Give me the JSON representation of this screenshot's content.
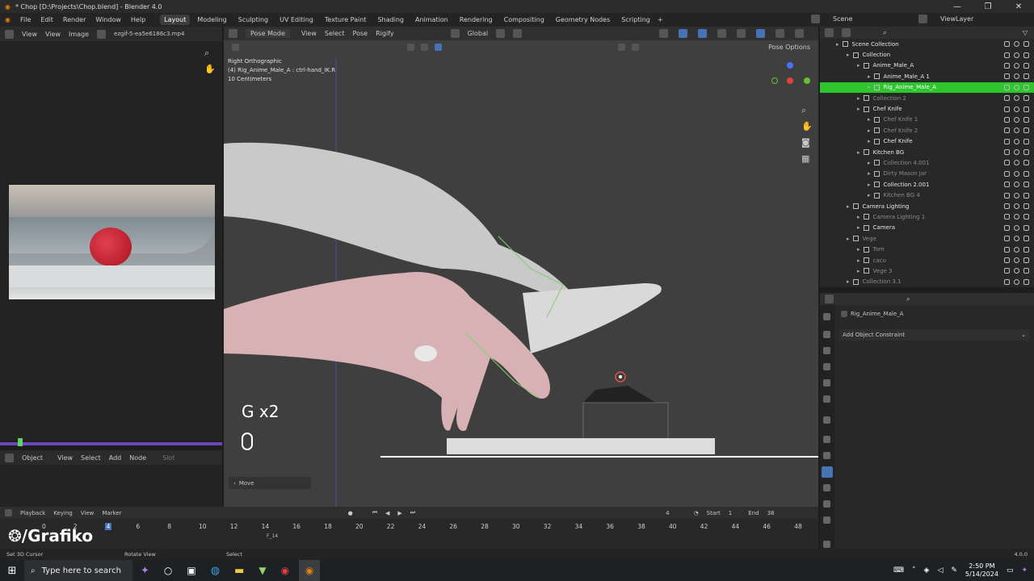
{
  "title": "* Chop [D:\\Projects\\Chop.blend] - Blender 4.0",
  "menus": [
    "File",
    "Edit",
    "Render",
    "Window",
    "Help"
  ],
  "workspaces": [
    "Layout",
    "Modeling",
    "Sculpting",
    "UV Editing",
    "Texture Paint",
    "Shading",
    "Animation",
    "Rendering",
    "Compositing",
    "Geometry Nodes",
    "Scripting"
  ],
  "scene": "Scene",
  "viewlayer": "ViewLayer",
  "image_editor": {
    "view": "View",
    "view2": "View",
    "image": "Image",
    "filename": "ezgif-5-ea5e6186c3.mp4"
  },
  "node_editor": {
    "mode": "Object",
    "view": "View",
    "select": "Select",
    "add": "Add",
    "node": "Node",
    "slot": "Slot"
  },
  "viewport": {
    "mode": "Pose Mode",
    "view": "View",
    "select": "Select",
    "pose": "Pose",
    "rigify": "Rigify",
    "transform": "Global",
    "info1": "Right Orthographic",
    "info2": "(4) Rig_Anime_Male_A : ctrl-hand_IK.R",
    "info3": "10 Centimeters",
    "options": "Pose Options",
    "key_hint": "G x2",
    "operator": "Move"
  },
  "outliner": [
    {
      "name": "Scene Collection",
      "indent": 0,
      "dim": false
    },
    {
      "name": "Collection",
      "indent": 1,
      "dim": false
    },
    {
      "name": "Anime_Male_A",
      "indent": 2,
      "dim": false
    },
    {
      "name": "Anime_Male_A 1",
      "indent": 3,
      "dim": false
    },
    {
      "name": "Rig_Anime_Male_A",
      "indent": 3,
      "dim": false,
      "hl": true
    },
    {
      "name": "Collection 2",
      "indent": 2,
      "dim": true
    },
    {
      "name": "Chef Knife",
      "indent": 2,
      "dim": false
    },
    {
      "name": "Chef Knife 1",
      "indent": 3,
      "dim": true
    },
    {
      "name": "Chef Knife 2",
      "indent": 3,
      "dim": true
    },
    {
      "name": "Chef Knife",
      "indent": 3,
      "dim": false
    },
    {
      "name": "Kitchen BG",
      "indent": 2,
      "dim": false
    },
    {
      "name": "Collection 4.001",
      "indent": 3,
      "dim": true
    },
    {
      "name": "Dirty Mason Jar",
      "indent": 3,
      "dim": true
    },
    {
      "name": "Collection 2.001",
      "indent": 3,
      "dim": false
    },
    {
      "name": "Kitchen BG 4",
      "indent": 3,
      "dim": true
    },
    {
      "name": "Camera Lighting",
      "indent": 1,
      "dim": false
    },
    {
      "name": "Camera Lighting 1",
      "indent": 2,
      "dim": true
    },
    {
      "name": "Camera",
      "indent": 2,
      "dim": false
    },
    {
      "name": "Vege",
      "indent": 1,
      "dim": true
    },
    {
      "name": "Tom",
      "indent": 2,
      "dim": true
    },
    {
      "name": "cacu",
      "indent": 2,
      "dim": true
    },
    {
      "name": "Vege 3",
      "indent": 2,
      "dim": true
    },
    {
      "name": "Collection 3.1",
      "indent": 1,
      "dim": true
    }
  ],
  "properties": {
    "object": "Rig_Anime_Male_A",
    "add": "Add Object Constraint"
  },
  "timeline": {
    "playback": "Playback",
    "keying": "Keying",
    "view": "View",
    "marker": "Marker",
    "current": "4",
    "start_label": "Start",
    "start": "1",
    "end_label": "End",
    "end": "38",
    "ticks": [
      "0",
      "2",
      "4",
      "6",
      "8",
      "10",
      "12",
      "14",
      "16",
      "18",
      "20",
      "22",
      "24",
      "26",
      "28",
      "30",
      "32",
      "34",
      "36",
      "38",
      "40",
      "42",
      "44",
      "46",
      "48"
    ],
    "marker_label": "F_14"
  },
  "status": {
    "left": "Set 3D Cursor",
    "mid": "Rotate View",
    "right": "Select",
    "version": "4.0.0"
  },
  "watermark": "/Grafiko",
  "taskbar": {
    "search": "Type here to search",
    "time": "2:50 PM",
    "date": "5/14/2024"
  },
  "colors": {
    "accent": "#4772b3",
    "highlight": "#2fc52f",
    "pose_green": "#7fd06f"
  }
}
